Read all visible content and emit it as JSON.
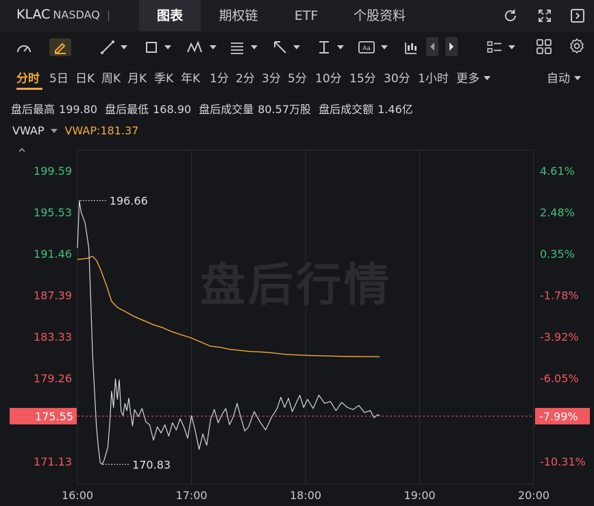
{
  "header": {
    "symbol": "KLAC",
    "exchange": "NASDAQ",
    "tabs": [
      {
        "label": "图表",
        "active": true
      },
      {
        "label": "期权链",
        "active": false
      },
      {
        "label": "ETF",
        "active": false
      },
      {
        "label": "个股资料",
        "active": false
      }
    ],
    "icons": [
      "refresh-icon",
      "fullscreen-icon",
      "collapse-panel-icon"
    ]
  },
  "toolbar": {
    "tools": [
      "gauge-icon",
      "pen-icon",
      "line-tool-icon",
      "rectangle-tool-icon",
      "pattern-tool-icon",
      "fib-tool-icon",
      "arrow-tool-icon",
      "measure-tool-icon",
      "text-tool-icon",
      "candle-style-icon",
      "prev-icon",
      "next-icon",
      "layout-list-icon",
      "grid-icon",
      "settings-icon"
    ]
  },
  "periods": {
    "items": [
      "分时",
      "5日",
      "日K",
      "周K",
      "月K",
      "季K",
      "年K",
      "1分",
      "2分",
      "3分",
      "5分",
      "10分",
      "15分",
      "30分",
      "1小时",
      "更多"
    ],
    "active": "分时",
    "auto_label": "自动"
  },
  "stats": {
    "high_label": "盘后最高",
    "high_value": "199.80",
    "low_label": "盘后最低",
    "low_value": "168.90",
    "volume_label": "盘后成交量",
    "volume_value": "80.57万股",
    "amount_label": "盘后成交额",
    "amount_value": "1.46亿"
  },
  "indicator": {
    "name": "VWAP",
    "value_label": "VWAP:181.37"
  },
  "watermark": "盘后行情",
  "colors": {
    "background": "#16171b",
    "up": "#3fbf7f",
    "down": "#f0595e",
    "vwap": "#f2a93b",
    "price_line": "#d8d9dc",
    "grid": "#2c2d32",
    "accent": "#f2a93b"
  },
  "chart_data": {
    "type": "line",
    "title": "",
    "xlabel": "",
    "ylabel": "",
    "x_ticks": [
      "16:00",
      "17:00",
      "18:00",
      "19:00",
      "20:00"
    ],
    "ylim": [
      168.9,
      201.6
    ],
    "reference_price": 190.81,
    "y_ticks_left": [
      "199.59",
      "195.53",
      "191.46",
      "187.39",
      "183.33",
      "179.26",
      "175.55",
      "171.13"
    ],
    "y_ticks_right": [
      "4.61%",
      "2.48%",
      "0.35%",
      "-1.78%",
      "-3.92%",
      "-6.05%",
      "-7.99%",
      "-10.31%"
    ],
    "current_price": {
      "label": "175.55",
      "pct": "-7.99%",
      "value": 175.55
    },
    "high_annotation": {
      "label": "196.66",
      "time": "16:01",
      "value": 196.66
    },
    "low_annotation": {
      "label": "170.83",
      "time": "16:13",
      "value": 170.83
    },
    "series": [
      {
        "name": "VWAP",
        "x": [
          "16:00",
          "16:05",
          "16:08",
          "16:10",
          "16:12",
          "16:15",
          "16:18",
          "16:21",
          "16:25",
          "16:30",
          "16:35",
          "16:40",
          "16:45",
          "16:50",
          "16:55",
          "17:00",
          "17:05",
          "17:10",
          "17:15",
          "17:20",
          "17:30",
          "17:40",
          "17:50",
          "18:00",
          "18:10",
          "18:20",
          "18:30",
          "18:39"
        ],
        "values": [
          190.9,
          191.0,
          191.2,
          190.8,
          190.0,
          188.5,
          186.8,
          186.2,
          185.8,
          185.3,
          184.9,
          184.5,
          184.2,
          183.8,
          183.5,
          183.2,
          182.8,
          182.4,
          182.3,
          182.1,
          181.9,
          181.8,
          181.6,
          181.5,
          181.45,
          181.4,
          181.38,
          181.37
        ]
      },
      {
        "name": "",
        "x": [
          "16:00",
          "16:01",
          "16:02",
          "16:04",
          "16:06",
          "16:07",
          "16:08",
          "16:09",
          "16:10",
          "16:11",
          "16:12",
          "16:13",
          "16:14",
          "16:16",
          "16:17",
          "16:18",
          "16:19",
          "16:20",
          "16:21",
          "16:22",
          "16:23",
          "16:24",
          "16:25",
          "16:26",
          "16:27",
          "16:28",
          "16:29",
          "16:30",
          "16:32",
          "16:34",
          "16:36",
          "16:38",
          "16:40",
          "16:42",
          "16:44",
          "16:46",
          "16:48",
          "16:50",
          "16:52",
          "16:54",
          "16:56",
          "16:58",
          "17:00",
          "17:02",
          "17:04",
          "17:06",
          "17:08",
          "17:10",
          "17:12",
          "17:14",
          "17:16",
          "17:18",
          "17:20",
          "17:22",
          "17:24",
          "17:26",
          "17:28",
          "17:30",
          "17:33",
          "17:36",
          "17:39",
          "17:42",
          "17:45",
          "17:47",
          "17:49",
          "17:51",
          "17:53",
          "17:55",
          "17:57",
          "17:59",
          "18:01",
          "18:04",
          "18:07",
          "18:10",
          "18:13",
          "18:16",
          "18:19",
          "18:22",
          "18:25",
          "18:28",
          "18:31",
          "18:34",
          "18:36",
          "18:38",
          "18:39"
        ],
        "values": [
          192.0,
          196.66,
          195.5,
          194.5,
          192.0,
          187.0,
          181.5,
          178.0,
          174.5,
          172.5,
          171.0,
          170.83,
          171.2,
          172.5,
          174.8,
          178.0,
          176.4,
          179.2,
          177.2,
          179.1,
          176.0,
          175.6,
          176.8,
          176.1,
          177.3,
          175.8,
          174.6,
          176.2,
          175.5,
          176.3,
          175.0,
          174.7,
          173.2,
          174.5,
          173.9,
          174.7,
          173.6,
          174.9,
          174.2,
          175.3,
          174.5,
          173.4,
          175.6,
          174.1,
          172.3,
          173.8,
          172.7,
          175.2,
          176.2,
          174.9,
          175.7,
          176.3,
          174.7,
          175.5,
          176.8,
          175.4,
          174.1,
          174.5,
          176.0,
          175.0,
          174.2,
          175.4,
          176.3,
          177.4,
          176.4,
          177.3,
          176.0,
          176.8,
          177.6,
          176.4,
          177.2,
          176.3,
          177.6,
          176.8,
          177.0,
          176.1,
          176.9,
          176.4,
          176.2,
          176.6,
          175.9,
          176.1,
          175.4,
          175.7,
          175.6
        ]
      }
    ],
    "grid": true
  }
}
